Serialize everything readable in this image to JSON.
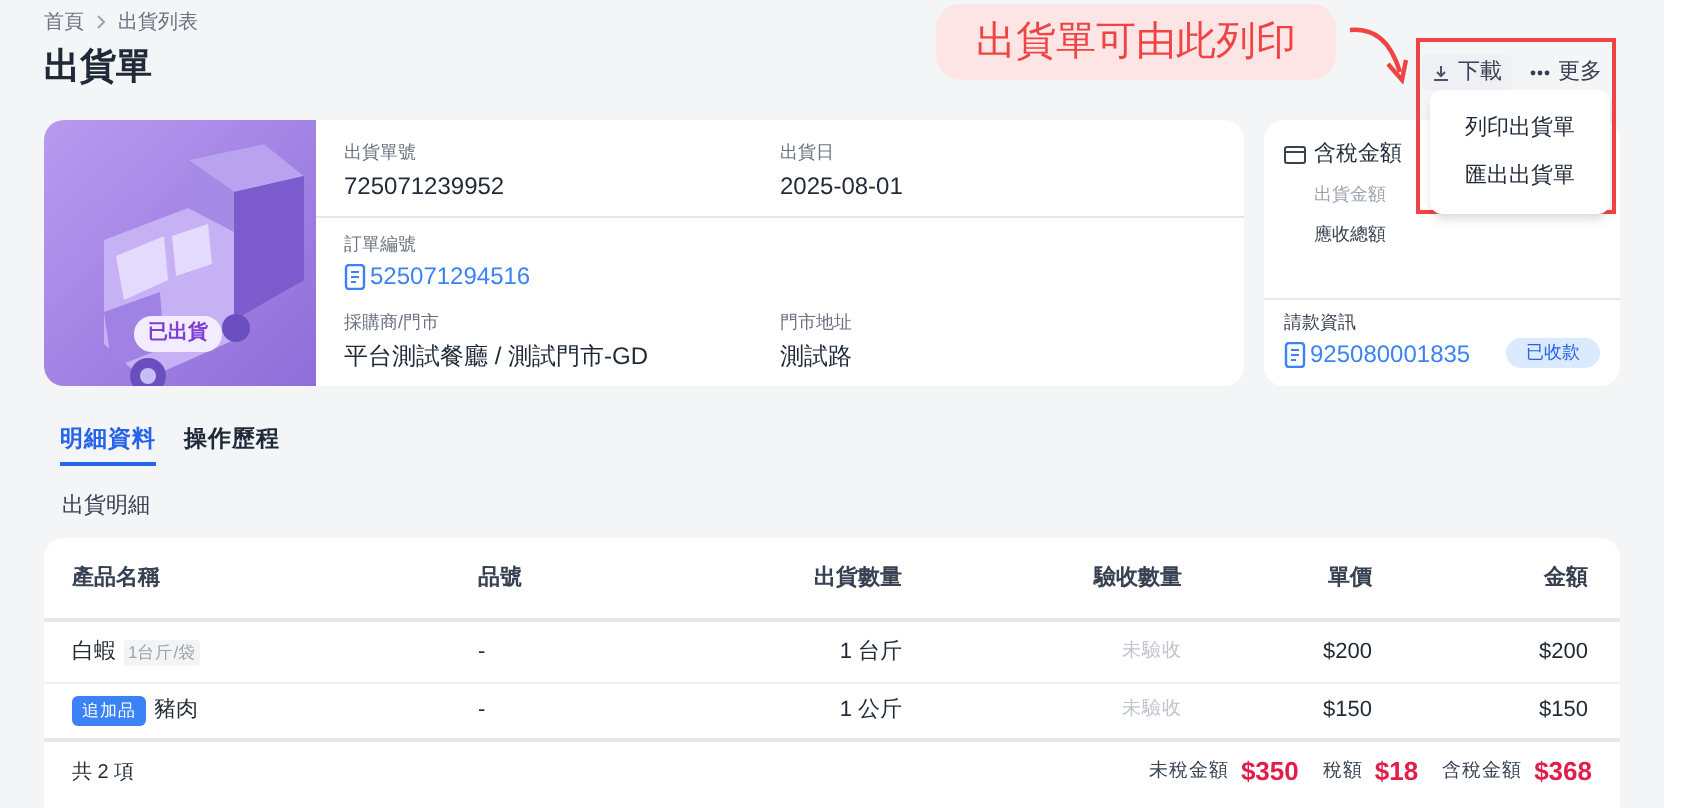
{
  "breadcrumb": [
    {
      "label": "首頁"
    },
    {
      "label": "出貨列表"
    }
  ],
  "title": "出貨單",
  "annotation": "出貨單可由此列印",
  "actions": [
    {
      "kind": "download",
      "label": "下載"
    },
    {
      "kind": "more",
      "label": "更多"
    }
  ],
  "menu": [
    "列印出貨單",
    "匯出出貨單"
  ],
  "status_badge": "已出貨",
  "fields": [
    {
      "label": "出貨單號",
      "value": "725071239952",
      "kind": "text"
    },
    {
      "label": "出貨日",
      "value": "2025-08-01",
      "kind": "text"
    },
    {
      "label": "訂單編號",
      "value": "525071294516",
      "kind": "link"
    },
    {
      "label": "採購商/門市",
      "value": "平台測試餐廳 / 測試門市-GD",
      "kind": "text"
    },
    {
      "label": "門市地址",
      "value": "測試路",
      "kind": "text"
    }
  ],
  "summary": {
    "title": "含稅金額",
    "rows": [
      "出貨金額",
      "應收總額"
    ],
    "invoice_label": "請款資訊",
    "invoice_number": "925080001835",
    "invoice_status": "已收款"
  },
  "tabs": [
    {
      "label": "明細資料",
      "selected": true
    },
    {
      "label": "操作歷程",
      "selected": false
    }
  ],
  "section_title": "出貨明細",
  "table": {
    "columns": [
      "產品名稱",
      "品號",
      "出貨數量",
      "驗收數量",
      "單價",
      "金額"
    ],
    "rows": [
      {
        "name": "白蝦",
        "spec": "1台斤/袋",
        "code": "-",
        "shipped": "1 台斤",
        "received": "未驗收",
        "price": "$200",
        "amount": "$200"
      },
      {
        "tag": "追加品",
        "name": "豬肉",
        "code": "-",
        "shipped": "1 公斤",
        "received": "未驗收",
        "price": "$150",
        "amount": "$150"
      }
    ],
    "count": "共 2 項",
    "totals": [
      {
        "label": "未稅金額",
        "value": "$350"
      },
      {
        "label": "稅額",
        "value": "$18"
      },
      {
        "label": "含稅金額",
        "value": "$368"
      }
    ]
  }
}
